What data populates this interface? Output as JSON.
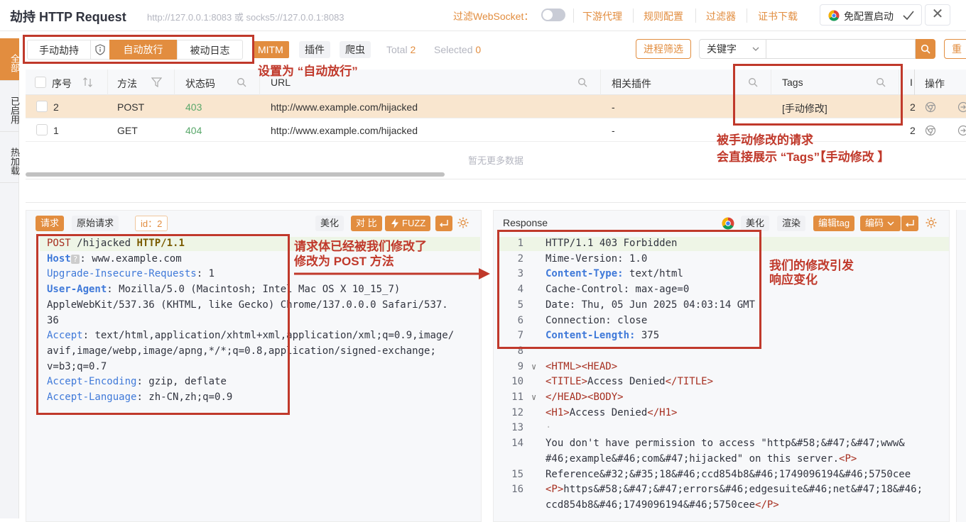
{
  "header": {
    "title": "劫持 HTTP Request",
    "address": "http://127.0.0.1:8083 或 socks5://127.0.0.1:8083",
    "ws_label": "过滤WebSocket：",
    "proxy": "下游代理",
    "rules": "规则配置",
    "filter": "过滤器",
    "cert": "证书下载",
    "launch": "免配置启动",
    "close": "✕"
  },
  "sidebar": {
    "items": [
      {
        "label": "全部"
      },
      {
        "label": "已启用"
      },
      {
        "label": "热加载"
      }
    ]
  },
  "toolbar": {
    "manual": "手动劫持",
    "auto": "自动放行",
    "passive": "被动日志",
    "mitm": "MITM",
    "plugin": "插件",
    "crawler": "爬虫",
    "total_label": "Total",
    "total": "2",
    "selected_label": "Selected",
    "selected": "0",
    "process_filter": "进程筛选",
    "keyword": "关键字",
    "reset": "重"
  },
  "table": {
    "headers": {
      "seq": "序号",
      "method": "方法",
      "status": "状态码",
      "url": "URL",
      "plugins": "相关插件",
      "tags": "Tags",
      "ip": "I",
      "action": "操作"
    },
    "rows": [
      {
        "seq": "2",
        "method": "POST",
        "status": "403",
        "url": "http://www.example.com/hijacked",
        "plugins": "-",
        "tags": "[手动修改]",
        "ip": "2"
      },
      {
        "seq": "1",
        "method": "GET",
        "status": "404",
        "url": "http://www.example.com/hijacked",
        "plugins": "-",
        "tags": "",
        "ip": "2"
      }
    ],
    "empty": "暂无更多数据"
  },
  "request": {
    "tab_req": "请求",
    "tab_raw": "原始请求",
    "id": "id：2",
    "beautify": "美化",
    "compare": "对 比",
    "fuzz": "FUZZ",
    "line1": {
      "method": "POST",
      "path": "/hijacked",
      "ver": "HTTP/1.1"
    },
    "host": {
      "k": "Host",
      "v": "www.example.com"
    },
    "upgrade": {
      "k": "Upgrade-Insecure-Requests",
      "v": "1"
    },
    "ua": {
      "k": "User-Agent",
      "v1": "Mozilla/5.0 (Macintosh; Intel Mac OS X 10_15_7)",
      "v2": "AppleWebKit/537.36 (KHTML, like Gecko) Chrome/137.0.0.0 Safari/537.",
      "v3": "36"
    },
    "accept": {
      "k": "Accept",
      "v1": "text/html,application/xhtml+xml,application/xml;q=0.9,image/",
      "v2": "avif,image/webp,image/apng,*/*;q=0.8,application/signed-exchange;",
      "v3": "v=b3;q=0.7"
    },
    "enc": {
      "k": "Accept-Encoding",
      "v": "gzip, deflate"
    },
    "lang": {
      "k": "Accept-Language",
      "v": "zh-CN,zh;q=0.9"
    }
  },
  "response": {
    "title": "Response",
    "beautify": "美化",
    "render": "渲染",
    "edit_tag": "编辑tag",
    "encode": "编码",
    "lines": {
      "l1": "HTTP/1.1 403 Forbidden",
      "l2": "Mime-Version: 1.0",
      "l3k": "Content-Type:",
      "l3v": "text/html",
      "l4": "Cache-Control: max-age=0",
      "l5": "Date: Thu, 05 Jun 2025 04:03:14 GMT",
      "l6": "Connection: close",
      "l7k": "Content-Length:",
      "l7v": "375",
      "l9a": "<HTML>",
      "l9b": "<HEAD>",
      "l10a": "<TITLE>",
      "l10b": "Access Denied",
      "l10c": "</TITLE>",
      "l11a": "</HEAD>",
      "l11b": "<BODY>",
      "l12a": "<H1>",
      "l12b": "Access Denied",
      "l12c": "</H1>",
      "l13": "·",
      "l14a": "You don't have permission to access \"http&#58;&#47;&#47;www&",
      "l14b": "#46;example&#46;com&#47;hijacked\" on this server.",
      "l14c": "<P>",
      "l15": "Reference&#32;&#35;18&#46;ccd854b8&#46;1749096194&#46;5750cee",
      "l16a": "<P>",
      "l16b": "https&#58;&#47;&#47;errors&#46;edgesuite&#46;net&#47;18&#46;",
      "l16c": "ccd854b8&#46;1749096194&#46;5750cee",
      "l16d": "</P>"
    },
    "nums": [
      "1",
      "2",
      "3",
      "4",
      "5",
      "6",
      "7",
      "8",
      "9",
      "10",
      "11",
      "12",
      "13",
      "14",
      "15",
      "16"
    ]
  },
  "annotations": {
    "a1": "设置为 “自动放行”",
    "a2l1": "被手动修改的请求",
    "a2l2": "会直接展示 “Tags”【手动修改 】",
    "a3l1": "请求体已经被我们修改了",
    "a3l2": "修改为 POST 方法",
    "a4l1": "我们的修改引发",
    "a4l2": "响应变化"
  },
  "colors": {
    "accent": "#e28d3f",
    "annotation": "#c0392b"
  }
}
